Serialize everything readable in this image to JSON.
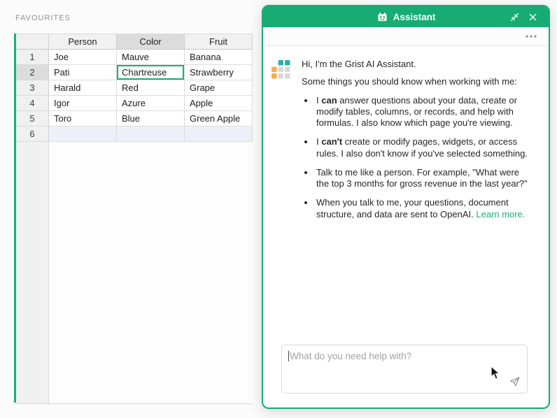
{
  "page": {
    "view_label": "FAVOURITES"
  },
  "grid": {
    "columns": [
      "Person",
      "Color",
      "Fruit"
    ],
    "rows": [
      {
        "num": "1",
        "cells": [
          "Joe",
          "Mauve",
          "Banana"
        ]
      },
      {
        "num": "2",
        "cells": [
          "Pati",
          "Chartreuse",
          "Strawberry"
        ]
      },
      {
        "num": "3",
        "cells": [
          "Harald",
          "Red",
          "Grape"
        ]
      },
      {
        "num": "4",
        "cells": [
          "Igor",
          "Azure",
          "Apple"
        ]
      },
      {
        "num": "5",
        "cells": [
          "Toro",
          "Blue",
          "Green Apple"
        ]
      },
      {
        "num": "6",
        "cells": [
          "",
          "",
          ""
        ]
      }
    ],
    "selected_cell": {
      "row": 2,
      "column": "Color",
      "value": "Chartreuse"
    }
  },
  "assistant": {
    "title": "Assistant",
    "greeting": "Hi, I'm the Grist AI Assistant.",
    "intro": "Some things you should know when working with me:",
    "bullets": {
      "b1": {
        "pre": "I ",
        "bold": "can",
        "post": " answer questions about your data, create or modify tables, columns, or records, and help with formulas. I also know which page you're viewing."
      },
      "b2": {
        "pre": "I ",
        "bold": "can't",
        "post": " create or modify pages, widgets, or access rules. I also don't know if you've selected something."
      },
      "b3": {
        "text": "Talk to me like a person. For example, \"What were the top 3 months for gross revenue in the last year?\""
      },
      "b4": {
        "text": "When you talk to me, your questions, document structure, and data are sent to OpenAI. ",
        "link": "Learn more."
      }
    },
    "input": {
      "placeholder": "What do you need help with?"
    }
  },
  "icons": [
    "robot-icon",
    "collapse-icon",
    "close-icon",
    "kebab-menu-icon",
    "grist-logo",
    "send-icon",
    "mouse-cursor",
    "text-caret"
  ],
  "colors": {
    "accent_green": "#16ac74",
    "selection_green": "#16b378",
    "link_green": "#16b378",
    "logo_teal": "#2cb1a7",
    "logo_orange": "#f9ae41",
    "logo_gray": "#d9d9d9",
    "add_row_bg": "#eef0f9",
    "header_gray": "#f1f1f1"
  }
}
